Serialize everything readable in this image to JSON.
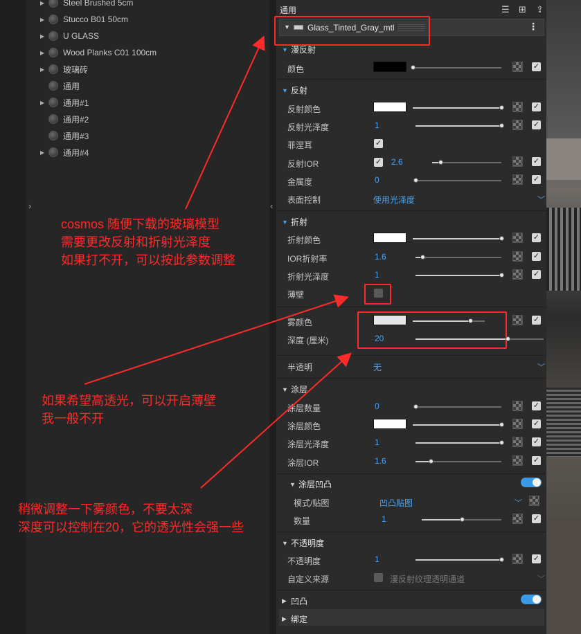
{
  "materials": [
    {
      "name": "Steel Brushed 5cm",
      "expandable": true
    },
    {
      "name": "Stucco B01 50cm",
      "expandable": true
    },
    {
      "name": "U GLASS",
      "expandable": true
    },
    {
      "name": "Wood Planks C01 100cm",
      "expandable": true
    },
    {
      "name": "玻璃砖",
      "expandable": true
    },
    {
      "name": "通用",
      "expandable": false
    },
    {
      "name": "通用#1",
      "expandable": true
    },
    {
      "name": "通用#2",
      "expandable": false
    },
    {
      "name": "通用#3",
      "expandable": false
    },
    {
      "name": "通用#4",
      "expandable": true
    }
  ],
  "panel": {
    "title": "通用",
    "material_name": "Glass_Tinted_Gray_mtl",
    "menu_glyph": "⋮"
  },
  "diffuse": {
    "title": "漫反射",
    "color_label": "颜色",
    "color": "#000000",
    "slider": 0.0
  },
  "reflection": {
    "title": "反射",
    "color_label": "反射颜色",
    "color": "#ffffff",
    "color_slider": 1.0,
    "gloss_label": "反射光泽度",
    "gloss_value": "1",
    "gloss_slider": 1.0,
    "fresnel_label": "菲涅耳",
    "fresnel_checked": true,
    "ior_label": "反射IOR",
    "ior_value": "2.6",
    "ior_slider": 0.12,
    "metal_label": "金属度",
    "metal_value": "0",
    "metal_slider": 0.0,
    "surface_label": "表面控制",
    "surface_value": "使用光泽度"
  },
  "refraction": {
    "title": "折射",
    "color_label": "折射颜色",
    "color": "#ffffff",
    "color_slider": 1.0,
    "ior_label": "IOR折射率",
    "ior_value": "1.6",
    "ior_slider": 0.08,
    "gloss_label": "折射光泽度",
    "gloss_value": "1",
    "gloss_slider": 1.0,
    "thin_label": "薄壁",
    "thin_checked": false,
    "fog_label": "雾颜色",
    "fog_color": "#e4e6e8",
    "fog_slider": 0.8,
    "depth_label": "深度 (厘米)",
    "depth_value": "20",
    "depth_slider": 0.72,
    "translucency_label": "半透明",
    "translucency_value": "无"
  },
  "coat": {
    "title": "涂层",
    "amount_label": "涂层数量",
    "amount_value": "0",
    "amount_slider": 0.0,
    "color_label": "涂层颜色",
    "color": "#ffffff",
    "color_slider": 1.0,
    "gloss_label": "涂层光泽度",
    "gloss_value": "1",
    "gloss_slider": 1.0,
    "ior_label": "涂层IOR",
    "ior_value": "1.6",
    "ior_slider": 0.18,
    "bump_title": "涂层凹凸",
    "bump_enabled": true,
    "mode_label": "模式/贴图",
    "mode_value": "凹凸贴图",
    "count_label": "数量",
    "count_value": "1",
    "count_slider": 0.5
  },
  "opacity": {
    "title": "不透明度",
    "opacity_label": "不透明度",
    "opacity_value": "1",
    "opacity_slider": 1.0,
    "source_label": "自定义来源",
    "source_value": "漫反射纹理透明通道"
  },
  "bump": {
    "title": "凹凸",
    "enabled": true
  },
  "binding": {
    "title": "绑定"
  },
  "annotations": {
    "note1": [
      "cosmos 随便下载的玻璃模型",
      "需要更改反射和折射光泽度",
      "如果打不开，可以按此参数调整"
    ],
    "note2": [
      "如果希望高透光，可以开启薄壁",
      "我一般不开"
    ],
    "note3": [
      "稍微调整一下雾颜色，不要太深",
      "深度可以控制在20，它的透光性会强一些"
    ]
  },
  "colors": {
    "accent": "#4aa3f0",
    "annotation": "#ff2a2a",
    "panel": "#2b2b2b"
  }
}
